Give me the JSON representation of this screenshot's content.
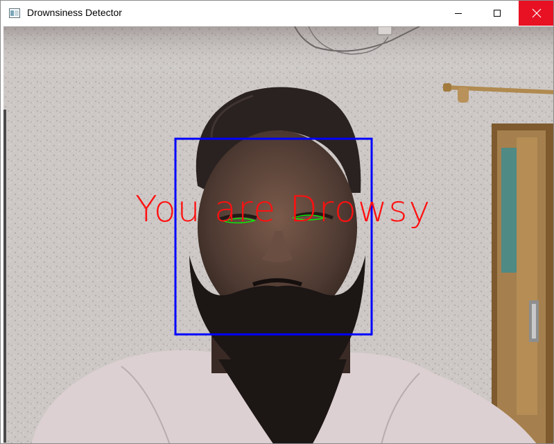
{
  "window": {
    "title": "Drownsiness Detector",
    "controls": {
      "minimize_icon": "minimize-icon",
      "maximize_icon": "maximize-icon",
      "close_icon": "close-icon"
    }
  },
  "video": {
    "alert_text": "You are Drowsy",
    "alert_color": "#ff1010",
    "face_box_color": "#0000ff",
    "eye_contour_color": "#00ff00"
  }
}
